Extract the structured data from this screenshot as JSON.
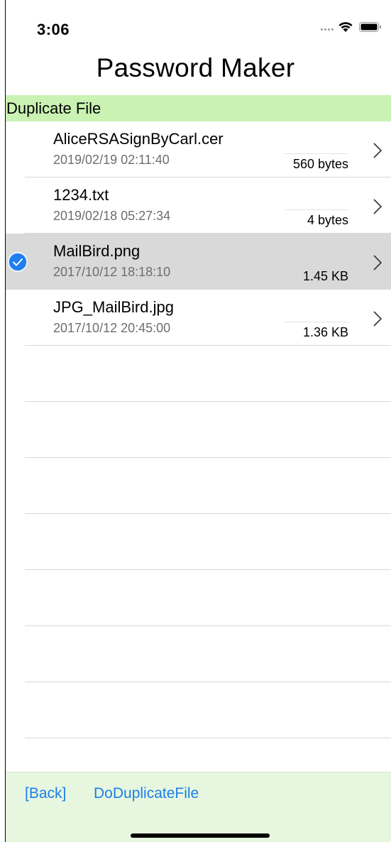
{
  "status_bar": {
    "time": "3:06",
    "icons": [
      "signal-dots-icon",
      "wifi-icon",
      "battery-icon"
    ]
  },
  "title": "Password Maker",
  "section": {
    "label": "Duplicate File",
    "color": "#c9f2b3"
  },
  "files": [
    {
      "name": "AliceRSASignByCarl.cer",
      "date": "2019/02/19  02:11:40",
      "size": "560 bytes",
      "selected": false
    },
    {
      "name": "1234.txt",
      "date": "2019/02/18  05:27:34",
      "size": "4 bytes",
      "selected": false
    },
    {
      "name": "MailBird.png",
      "date": "2017/10/12  18:18:10",
      "size": "1.45 KB",
      "selected": true
    },
    {
      "name": "JPG_MailBird.jpg",
      "date": "2017/10/12  20:45:00",
      "size": "1.36 KB",
      "selected": false
    }
  ],
  "toolbar": {
    "back_label": "[Back]",
    "action_label": "DoDuplicateFile",
    "link_color": "#1a7ee8"
  }
}
